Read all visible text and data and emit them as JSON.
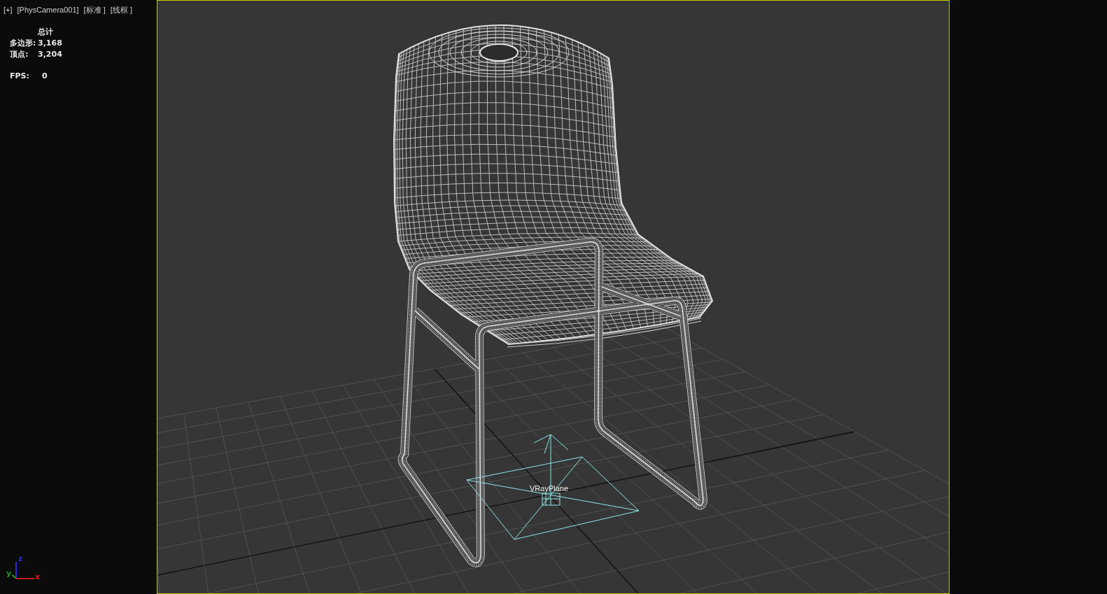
{
  "viewport": {
    "labels": [
      "[+]",
      "[PhysCamera001]",
      "[标准 ]",
      "[线框 ]"
    ],
    "stats": {
      "heading": "总计",
      "rows": [
        {
          "label": "多边形:",
          "value": "3,168"
        },
        {
          "label": "顶点:",
          "value": "3,204"
        }
      ]
    },
    "fps": {
      "label": "FPS:",
      "value": "0"
    },
    "scene": {
      "object_label": "VRayPlane"
    },
    "axes": [
      {
        "label": "z",
        "color": "#2b2bd8"
      },
      {
        "label": "y",
        "color": "#1f9a1f"
      },
      {
        "label": "x",
        "color": "#c41a1a"
      }
    ]
  }
}
